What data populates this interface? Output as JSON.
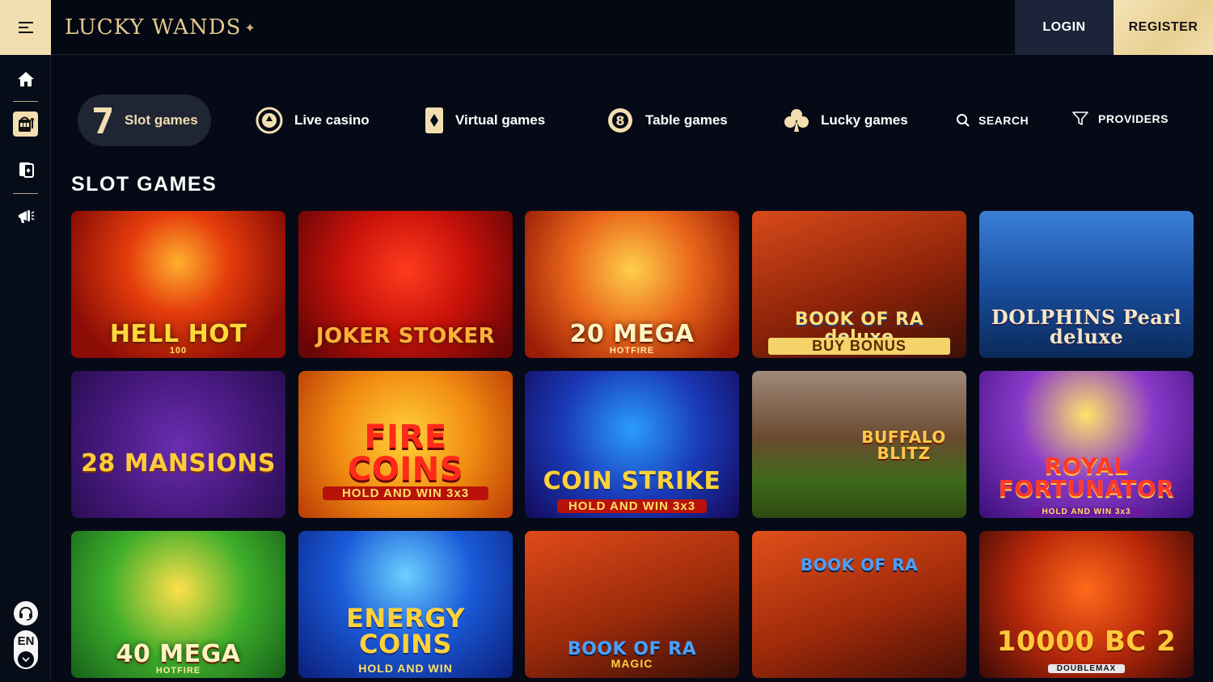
{
  "header": {
    "logo_text": "LUCKY WANDS",
    "login_label": "LOGIN",
    "register_label": "REGISTER"
  },
  "sidebar": {
    "items": [
      {
        "icon": "home-icon"
      },
      {
        "icon": "slot-machine-icon",
        "active": true
      },
      {
        "icon": "cards-icon"
      },
      {
        "icon": "megaphone-icon"
      }
    ],
    "support_icon": "headset-icon",
    "language": "EN"
  },
  "categories": [
    {
      "label": "Slot games",
      "icon": "seven-icon",
      "active": true
    },
    {
      "label": "Live casino",
      "icon": "chip-icon"
    },
    {
      "label": "Virtual games",
      "icon": "card-diamond-icon"
    },
    {
      "label": "Table games",
      "icon": "ball-eight-icon"
    },
    {
      "label": "Lucky games",
      "icon": "clover-icon"
    },
    {
      "label": "SEARCH",
      "icon": "search-icon"
    },
    {
      "label": "PROVIDERS",
      "icon": "filter-icon"
    }
  ],
  "section_title": "SLOT GAMES",
  "games": [
    {
      "title": "HELL HOT",
      "sub": "100"
    },
    {
      "title": "JOKER STOKER",
      "sub": ""
    },
    {
      "title": "20 MEGA",
      "sub": "HOTFIRE"
    },
    {
      "title": "BOOK OF RA deluxe",
      "sub": "BUY BONUS"
    },
    {
      "title": "DOLPHINS Pearl deluxe",
      "sub": ""
    },
    {
      "title": "28 MANSIONS",
      "sub": ""
    },
    {
      "title": "FIRE COINS",
      "sub": "HOLD AND WIN 3x3"
    },
    {
      "title": "COIN STRIKE",
      "sub": "HOLD AND WIN 3x3"
    },
    {
      "title": "BUFFALO BLITZ",
      "sub": ""
    },
    {
      "title": "ROYAL FORTUNATOR",
      "sub": "HOLD AND WIN 3x3"
    },
    {
      "title": "40 MEGA",
      "sub": "HOTFIRE"
    },
    {
      "title": "ENERGY COINS",
      "sub": "HOLD AND WIN"
    },
    {
      "title": "BOOK OF RA",
      "sub": "MAGIC"
    },
    {
      "title": "BOOK OF RA",
      "sub": ""
    },
    {
      "title": "10000 BC 2",
      "sub": "DOUBLEMAX"
    }
  ]
}
